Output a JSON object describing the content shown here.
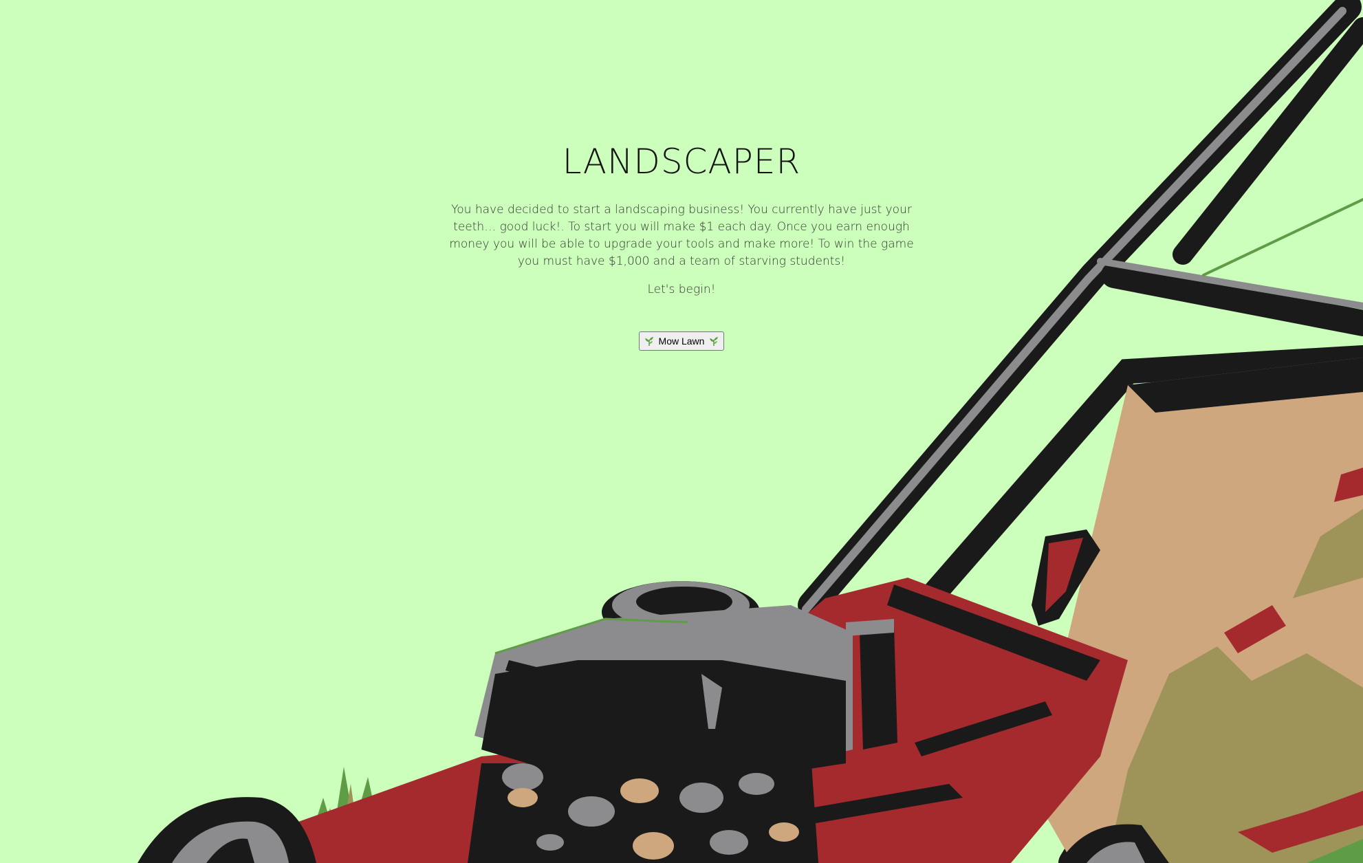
{
  "game": {
    "title": "LANDSCAPER",
    "intro": "You have decided to start a landscaping business! You currently have just your teeth… good luck!. To start you will make $1 each day. Once you earn enough money you will be able to upgrade your tools and make more! To win the game you must have $1,000 and a team of starving students!",
    "prompt": "Let's begin!",
    "action_button": {
      "label": "Mow Lawn",
      "icon": "herb-icon"
    }
  },
  "colors": {
    "background": "#ccffbb",
    "mower_red": "#a52a2e",
    "mower_black": "#1a1a1a",
    "mower_gray": "#8c8c8e",
    "bag_tan": "#cfa77e",
    "bag_olive": "#9e9459",
    "grass_green": "#5e9c46"
  }
}
